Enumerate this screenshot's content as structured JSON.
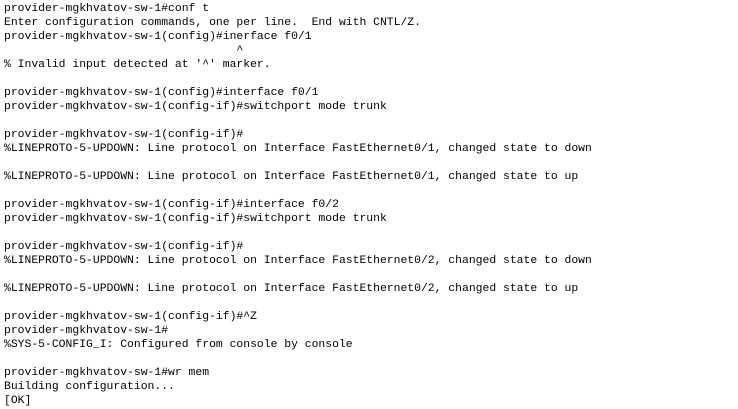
{
  "terminal": {
    "lines": [
      "provider-mgkhvatov-sw-1#conf t",
      "Enter configuration commands, one per line.  End with CNTL/Z.",
      "provider-mgkhvatov-sw-1(config)#inerface f0/1",
      "                                  ^",
      "% Invalid input detected at '^' marker.",
      "",
      "provider-mgkhvatov-sw-1(config)#interface f0/1",
      "provider-mgkhvatov-sw-1(config-if)#switchport mode trunk",
      "",
      "provider-mgkhvatov-sw-1(config-if)#",
      "%LINEPROTO-5-UPDOWN: Line protocol on Interface FastEthernet0/1, changed state to down",
      "",
      "%LINEPROTO-5-UPDOWN: Line protocol on Interface FastEthernet0/1, changed state to up",
      "",
      "provider-mgkhvatov-sw-1(config-if)#interface f0/2",
      "provider-mgkhvatov-sw-1(config-if)#switchport mode trunk",
      "",
      "provider-mgkhvatov-sw-1(config-if)#",
      "%LINEPROTO-5-UPDOWN: Line protocol on Interface FastEthernet0/2, changed state to down",
      "",
      "%LINEPROTO-5-UPDOWN: Line protocol on Interface FastEthernet0/2, changed state to up",
      "",
      "provider-mgkhvatov-sw-1(config-if)#^Z",
      "provider-mgkhvatov-sw-1#",
      "%SYS-5-CONFIG_I: Configured from console by console",
      "",
      "provider-mgkhvatov-sw-1#wr mem",
      "Building configuration...",
      "[OK]"
    ]
  }
}
